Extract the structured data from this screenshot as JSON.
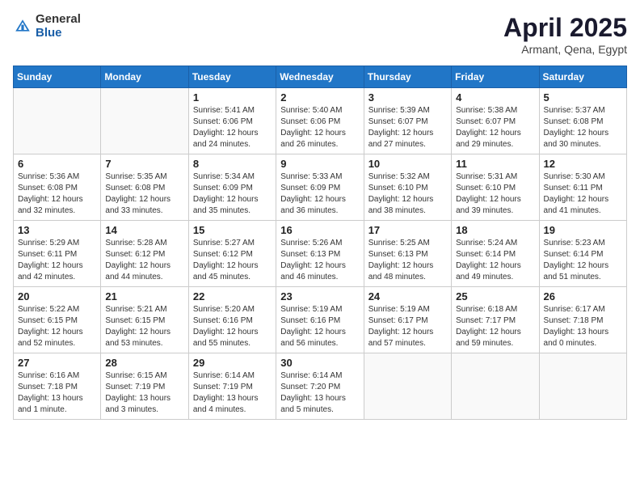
{
  "logo": {
    "general": "General",
    "blue": "Blue"
  },
  "header": {
    "month": "April 2025",
    "location": "Armant, Qena, Egypt"
  },
  "weekdays": [
    "Sunday",
    "Monday",
    "Tuesday",
    "Wednesday",
    "Thursday",
    "Friday",
    "Saturday"
  ],
  "weeks": [
    [
      {
        "day": "",
        "text": ""
      },
      {
        "day": "",
        "text": ""
      },
      {
        "day": "1",
        "text": "Sunrise: 5:41 AM\nSunset: 6:06 PM\nDaylight: 12 hours and 24 minutes."
      },
      {
        "day": "2",
        "text": "Sunrise: 5:40 AM\nSunset: 6:06 PM\nDaylight: 12 hours and 26 minutes."
      },
      {
        "day": "3",
        "text": "Sunrise: 5:39 AM\nSunset: 6:07 PM\nDaylight: 12 hours and 27 minutes."
      },
      {
        "day": "4",
        "text": "Sunrise: 5:38 AM\nSunset: 6:07 PM\nDaylight: 12 hours and 29 minutes."
      },
      {
        "day": "5",
        "text": "Sunrise: 5:37 AM\nSunset: 6:08 PM\nDaylight: 12 hours and 30 minutes."
      }
    ],
    [
      {
        "day": "6",
        "text": "Sunrise: 5:36 AM\nSunset: 6:08 PM\nDaylight: 12 hours and 32 minutes."
      },
      {
        "day": "7",
        "text": "Sunrise: 5:35 AM\nSunset: 6:08 PM\nDaylight: 12 hours and 33 minutes."
      },
      {
        "day": "8",
        "text": "Sunrise: 5:34 AM\nSunset: 6:09 PM\nDaylight: 12 hours and 35 minutes."
      },
      {
        "day": "9",
        "text": "Sunrise: 5:33 AM\nSunset: 6:09 PM\nDaylight: 12 hours and 36 minutes."
      },
      {
        "day": "10",
        "text": "Sunrise: 5:32 AM\nSunset: 6:10 PM\nDaylight: 12 hours and 38 minutes."
      },
      {
        "day": "11",
        "text": "Sunrise: 5:31 AM\nSunset: 6:10 PM\nDaylight: 12 hours and 39 minutes."
      },
      {
        "day": "12",
        "text": "Sunrise: 5:30 AM\nSunset: 6:11 PM\nDaylight: 12 hours and 41 minutes."
      }
    ],
    [
      {
        "day": "13",
        "text": "Sunrise: 5:29 AM\nSunset: 6:11 PM\nDaylight: 12 hours and 42 minutes."
      },
      {
        "day": "14",
        "text": "Sunrise: 5:28 AM\nSunset: 6:12 PM\nDaylight: 12 hours and 44 minutes."
      },
      {
        "day": "15",
        "text": "Sunrise: 5:27 AM\nSunset: 6:12 PM\nDaylight: 12 hours and 45 minutes."
      },
      {
        "day": "16",
        "text": "Sunrise: 5:26 AM\nSunset: 6:13 PM\nDaylight: 12 hours and 46 minutes."
      },
      {
        "day": "17",
        "text": "Sunrise: 5:25 AM\nSunset: 6:13 PM\nDaylight: 12 hours and 48 minutes."
      },
      {
        "day": "18",
        "text": "Sunrise: 5:24 AM\nSunset: 6:14 PM\nDaylight: 12 hours and 49 minutes."
      },
      {
        "day": "19",
        "text": "Sunrise: 5:23 AM\nSunset: 6:14 PM\nDaylight: 12 hours and 51 minutes."
      }
    ],
    [
      {
        "day": "20",
        "text": "Sunrise: 5:22 AM\nSunset: 6:15 PM\nDaylight: 12 hours and 52 minutes."
      },
      {
        "day": "21",
        "text": "Sunrise: 5:21 AM\nSunset: 6:15 PM\nDaylight: 12 hours and 53 minutes."
      },
      {
        "day": "22",
        "text": "Sunrise: 5:20 AM\nSunset: 6:16 PM\nDaylight: 12 hours and 55 minutes."
      },
      {
        "day": "23",
        "text": "Sunrise: 5:19 AM\nSunset: 6:16 PM\nDaylight: 12 hours and 56 minutes."
      },
      {
        "day": "24",
        "text": "Sunrise: 5:19 AM\nSunset: 6:17 PM\nDaylight: 12 hours and 57 minutes."
      },
      {
        "day": "25",
        "text": "Sunrise: 6:18 AM\nSunset: 7:17 PM\nDaylight: 12 hours and 59 minutes."
      },
      {
        "day": "26",
        "text": "Sunrise: 6:17 AM\nSunset: 7:18 PM\nDaylight: 13 hours and 0 minutes."
      }
    ],
    [
      {
        "day": "27",
        "text": "Sunrise: 6:16 AM\nSunset: 7:18 PM\nDaylight: 13 hours and 1 minute."
      },
      {
        "day": "28",
        "text": "Sunrise: 6:15 AM\nSunset: 7:19 PM\nDaylight: 13 hours and 3 minutes."
      },
      {
        "day": "29",
        "text": "Sunrise: 6:14 AM\nSunset: 7:19 PM\nDaylight: 13 hours and 4 minutes."
      },
      {
        "day": "30",
        "text": "Sunrise: 6:14 AM\nSunset: 7:20 PM\nDaylight: 13 hours and 5 minutes."
      },
      {
        "day": "",
        "text": ""
      },
      {
        "day": "",
        "text": ""
      },
      {
        "day": "",
        "text": ""
      }
    ]
  ]
}
